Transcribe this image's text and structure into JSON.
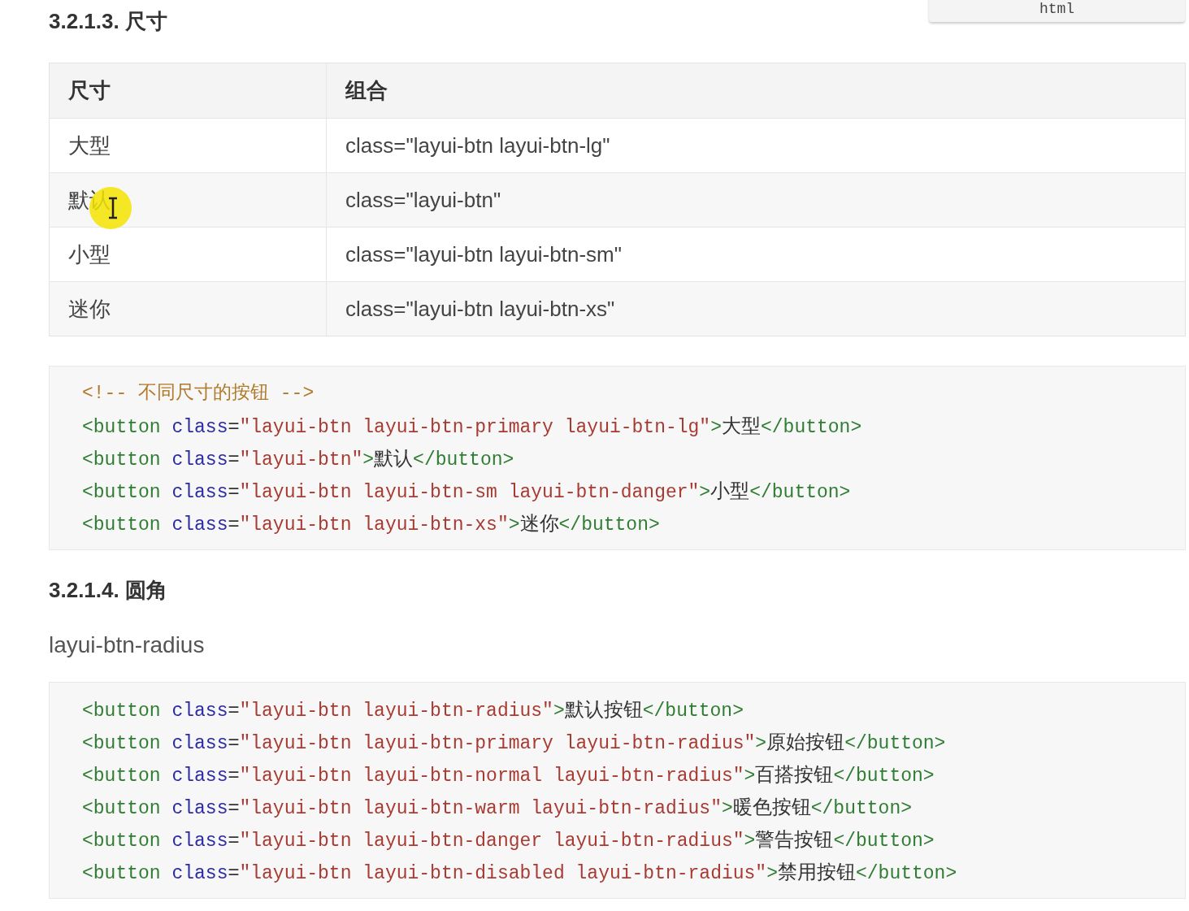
{
  "code_tab": {
    "label": "html"
  },
  "section_1": {
    "heading": "3.2.1.3. 尺寸",
    "table": {
      "columns": [
        "尺寸",
        "组合"
      ],
      "rows": [
        [
          "大型",
          "class=\"layui-btn layui-btn-lg\""
        ],
        [
          "默认",
          "class=\"layui-btn\""
        ],
        [
          "小型",
          "class=\"layui-btn layui-btn-sm\""
        ],
        [
          "迷你",
          "class=\"layui-btn layui-btn-xs\""
        ]
      ]
    },
    "code": [
      [
        {
          "kind": "comment",
          "text": "<!-- 不同尺寸的按钮 -->"
        }
      ],
      [
        {
          "kind": "tag",
          "text": "<button "
        },
        {
          "kind": "attr",
          "text": "class"
        },
        {
          "kind": "plain",
          "text": "="
        },
        {
          "kind": "string",
          "text": "\"layui-btn layui-btn-primary layui-btn-lg\""
        },
        {
          "kind": "tag",
          "text": ">"
        },
        {
          "kind": "plain",
          "text": "大型"
        },
        {
          "kind": "tag",
          "text": "</button>"
        }
      ],
      [
        {
          "kind": "tag",
          "text": "<button "
        },
        {
          "kind": "attr",
          "text": "class"
        },
        {
          "kind": "plain",
          "text": "="
        },
        {
          "kind": "string",
          "text": "\"layui-btn\""
        },
        {
          "kind": "tag",
          "text": ">"
        },
        {
          "kind": "plain",
          "text": "默认"
        },
        {
          "kind": "tag",
          "text": "</button>"
        }
      ],
      [
        {
          "kind": "tag",
          "text": "<button "
        },
        {
          "kind": "attr",
          "text": "class"
        },
        {
          "kind": "plain",
          "text": "="
        },
        {
          "kind": "string",
          "text": "\"layui-btn layui-btn-sm layui-btn-danger\""
        },
        {
          "kind": "tag",
          "text": ">"
        },
        {
          "kind": "plain",
          "text": "小型"
        },
        {
          "kind": "tag",
          "text": "</button>"
        }
      ],
      [
        {
          "kind": "tag",
          "text": "<button "
        },
        {
          "kind": "attr",
          "text": "class"
        },
        {
          "kind": "plain",
          "text": "="
        },
        {
          "kind": "string",
          "text": "\"layui-btn layui-btn-xs\""
        },
        {
          "kind": "tag",
          "text": ">"
        },
        {
          "kind": "plain",
          "text": "迷你"
        },
        {
          "kind": "tag",
          "text": "</button>"
        }
      ]
    ]
  },
  "section_2": {
    "heading": "3.2.1.4. 圆角",
    "paragraph": "layui-btn-radius",
    "code": [
      [
        {
          "kind": "tag",
          "text": "<button "
        },
        {
          "kind": "attr",
          "text": "class"
        },
        {
          "kind": "plain",
          "text": "="
        },
        {
          "kind": "string",
          "text": "\"layui-btn layui-btn-radius\""
        },
        {
          "kind": "tag",
          "text": ">"
        },
        {
          "kind": "plain",
          "text": "默认按钮"
        },
        {
          "kind": "tag",
          "text": "</button>"
        }
      ],
      [
        {
          "kind": "tag",
          "text": "<button "
        },
        {
          "kind": "attr",
          "text": "class"
        },
        {
          "kind": "plain",
          "text": "="
        },
        {
          "kind": "string",
          "text": "\"layui-btn layui-btn-primary layui-btn-radius\""
        },
        {
          "kind": "tag",
          "text": ">"
        },
        {
          "kind": "plain",
          "text": "原始按钮"
        },
        {
          "kind": "tag",
          "text": "</button>"
        }
      ],
      [
        {
          "kind": "tag",
          "text": "<button "
        },
        {
          "kind": "attr",
          "text": "class"
        },
        {
          "kind": "plain",
          "text": "="
        },
        {
          "kind": "string",
          "text": "\"layui-btn layui-btn-normal layui-btn-radius\""
        },
        {
          "kind": "tag",
          "text": ">"
        },
        {
          "kind": "plain",
          "text": "百搭按钮"
        },
        {
          "kind": "tag",
          "text": "</button>"
        }
      ],
      [
        {
          "kind": "tag",
          "text": "<button "
        },
        {
          "kind": "attr",
          "text": "class"
        },
        {
          "kind": "plain",
          "text": "="
        },
        {
          "kind": "string",
          "text": "\"layui-btn layui-btn-warm layui-btn-radius\""
        },
        {
          "kind": "tag",
          "text": ">"
        },
        {
          "kind": "plain",
          "text": "暖色按钮"
        },
        {
          "kind": "tag",
          "text": "</button>"
        }
      ],
      [
        {
          "kind": "tag",
          "text": "<button "
        },
        {
          "kind": "attr",
          "text": "class"
        },
        {
          "kind": "plain",
          "text": "="
        },
        {
          "kind": "string",
          "text": "\"layui-btn layui-btn-danger layui-btn-radius\""
        },
        {
          "kind": "tag",
          "text": ">"
        },
        {
          "kind": "plain",
          "text": "警告按钮"
        },
        {
          "kind": "tag",
          "text": "</button>"
        }
      ],
      [
        {
          "kind": "tag",
          "text": "<button "
        },
        {
          "kind": "attr",
          "text": "class"
        },
        {
          "kind": "plain",
          "text": "="
        },
        {
          "kind": "string",
          "text": "\"layui-btn layui-btn-disabled layui-btn-radius\""
        },
        {
          "kind": "tag",
          "text": ">"
        },
        {
          "kind": "plain",
          "text": "禁用按钮"
        },
        {
          "kind": "tag",
          "text": "</button>"
        }
      ]
    ]
  }
}
